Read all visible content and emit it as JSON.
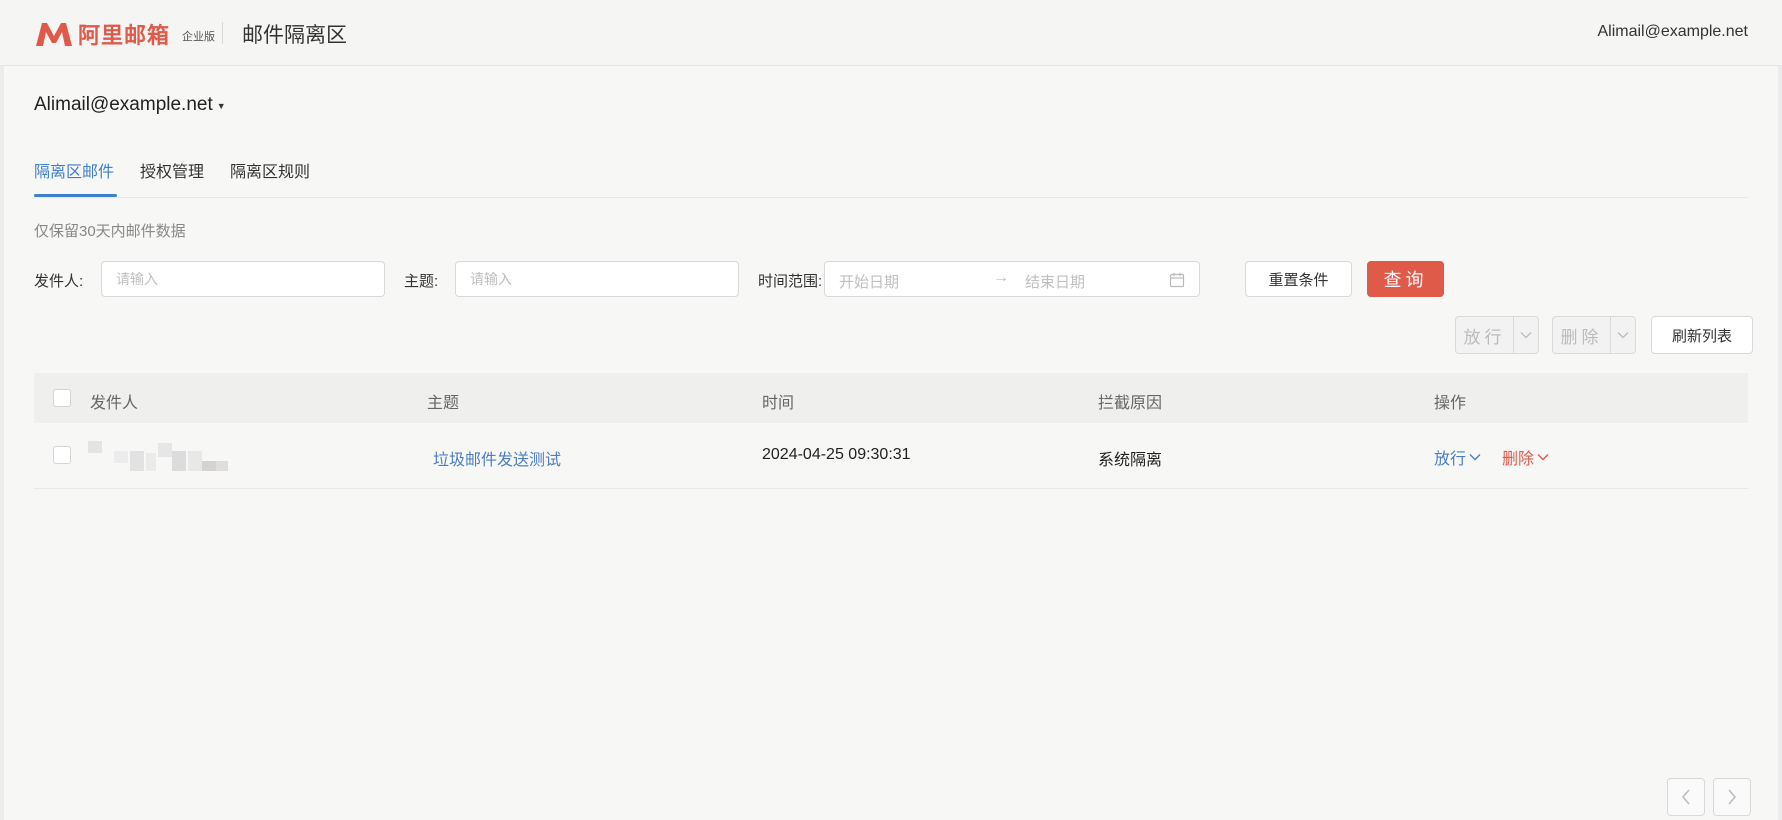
{
  "header": {
    "logo_text": "阿里邮箱",
    "edition": "企业版",
    "title": "邮件隔离区",
    "user": "Alimail@example.net"
  },
  "account": {
    "name": "Alimail@example.net"
  },
  "tabs": [
    {
      "label": "隔离区邮件",
      "active": true
    },
    {
      "label": "授权管理",
      "active": false
    },
    {
      "label": "隔离区规则",
      "active": false
    }
  ],
  "note": "仅保留30天内邮件数据",
  "filters": {
    "sender_label": "发件人:",
    "sender_placeholder": "请输入",
    "subject_label": "主题:",
    "subject_placeholder": "请输入",
    "time_label": "时间范围:",
    "start_placeholder": "开始日期",
    "end_placeholder": "结束日期",
    "reset_label": "重置条件",
    "query_label": "查询"
  },
  "toolbar": {
    "release_label": "放行",
    "delete_label": "删除",
    "refresh_label": "刷新列表"
  },
  "table": {
    "columns": [
      "发件人",
      "主题",
      "时间",
      "拦截原因",
      "操作"
    ],
    "rows": [
      {
        "subject": "垃圾邮件发送测试",
        "time": "2024-04-25 09:30:31",
        "reason": "系统隔离",
        "release": "放行",
        "delete": "删除"
      }
    ]
  },
  "colors": {
    "brand": "#e05a4a",
    "link": "#4a7fc6",
    "tab_active": "#3f7fcf"
  }
}
